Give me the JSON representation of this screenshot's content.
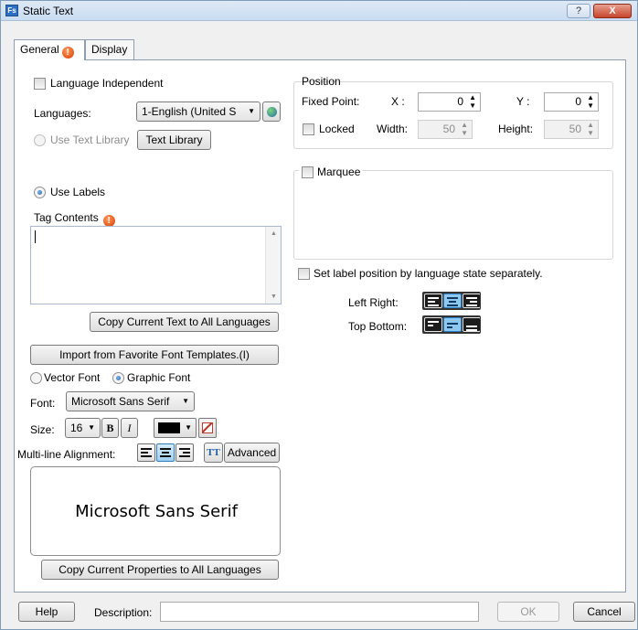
{
  "window": {
    "app_icon_text": "Fs",
    "title": "Static Text",
    "help_btn": "?",
    "close_btn": "X"
  },
  "tabs": [
    {
      "label": "General"
    },
    {
      "label": "Display"
    }
  ],
  "general": {
    "language_independent": "Language Independent",
    "languages_label": "Languages:",
    "language_value": "1-English (United S",
    "use_text_library": "Use Text Library",
    "text_library_btn": "Text Library",
    "use_labels": "Use Labels",
    "tag_contents": "Tag Contents",
    "copy_text_btn": "Copy Current Text to All Languages",
    "import_font_btn": "Import from Favorite Font Templates.(I)",
    "vector_font": "Vector Font",
    "graphic_font": "Graphic Font",
    "font_label": "Font:",
    "font_value": "Microsoft Sans Serif",
    "size_label": "Size:",
    "size_value": "16",
    "bold_btn": "B",
    "italic_btn": "I",
    "multiline_label": "Multi-line Alignment:",
    "advanced_btn": "Advanced",
    "tt_icon": "TT",
    "preview_text": "Microsoft Sans Serif",
    "copy_props_btn": "Copy Current Properties to All Languages",
    "text_color": "#000000"
  },
  "position": {
    "title": "Position",
    "fixed_point": "Fixed Point:",
    "x_label": "X :",
    "x_value": "0",
    "y_label": "Y :",
    "y_value": "0",
    "locked": "Locked",
    "width_label": "Width:",
    "width_value": "50",
    "height_label": "Height:",
    "height_value": "50"
  },
  "marquee": {
    "label": "Marquee"
  },
  "label_position": {
    "checkbox_label": "Set label position by language  state separately.",
    "left_right": "Left Right:",
    "top_bottom": "Top Bottom:"
  },
  "footer": {
    "help_btn": "Help",
    "description_label": "Description:",
    "description_value": "",
    "ok_btn": "OK",
    "cancel_btn": "Cancel"
  }
}
